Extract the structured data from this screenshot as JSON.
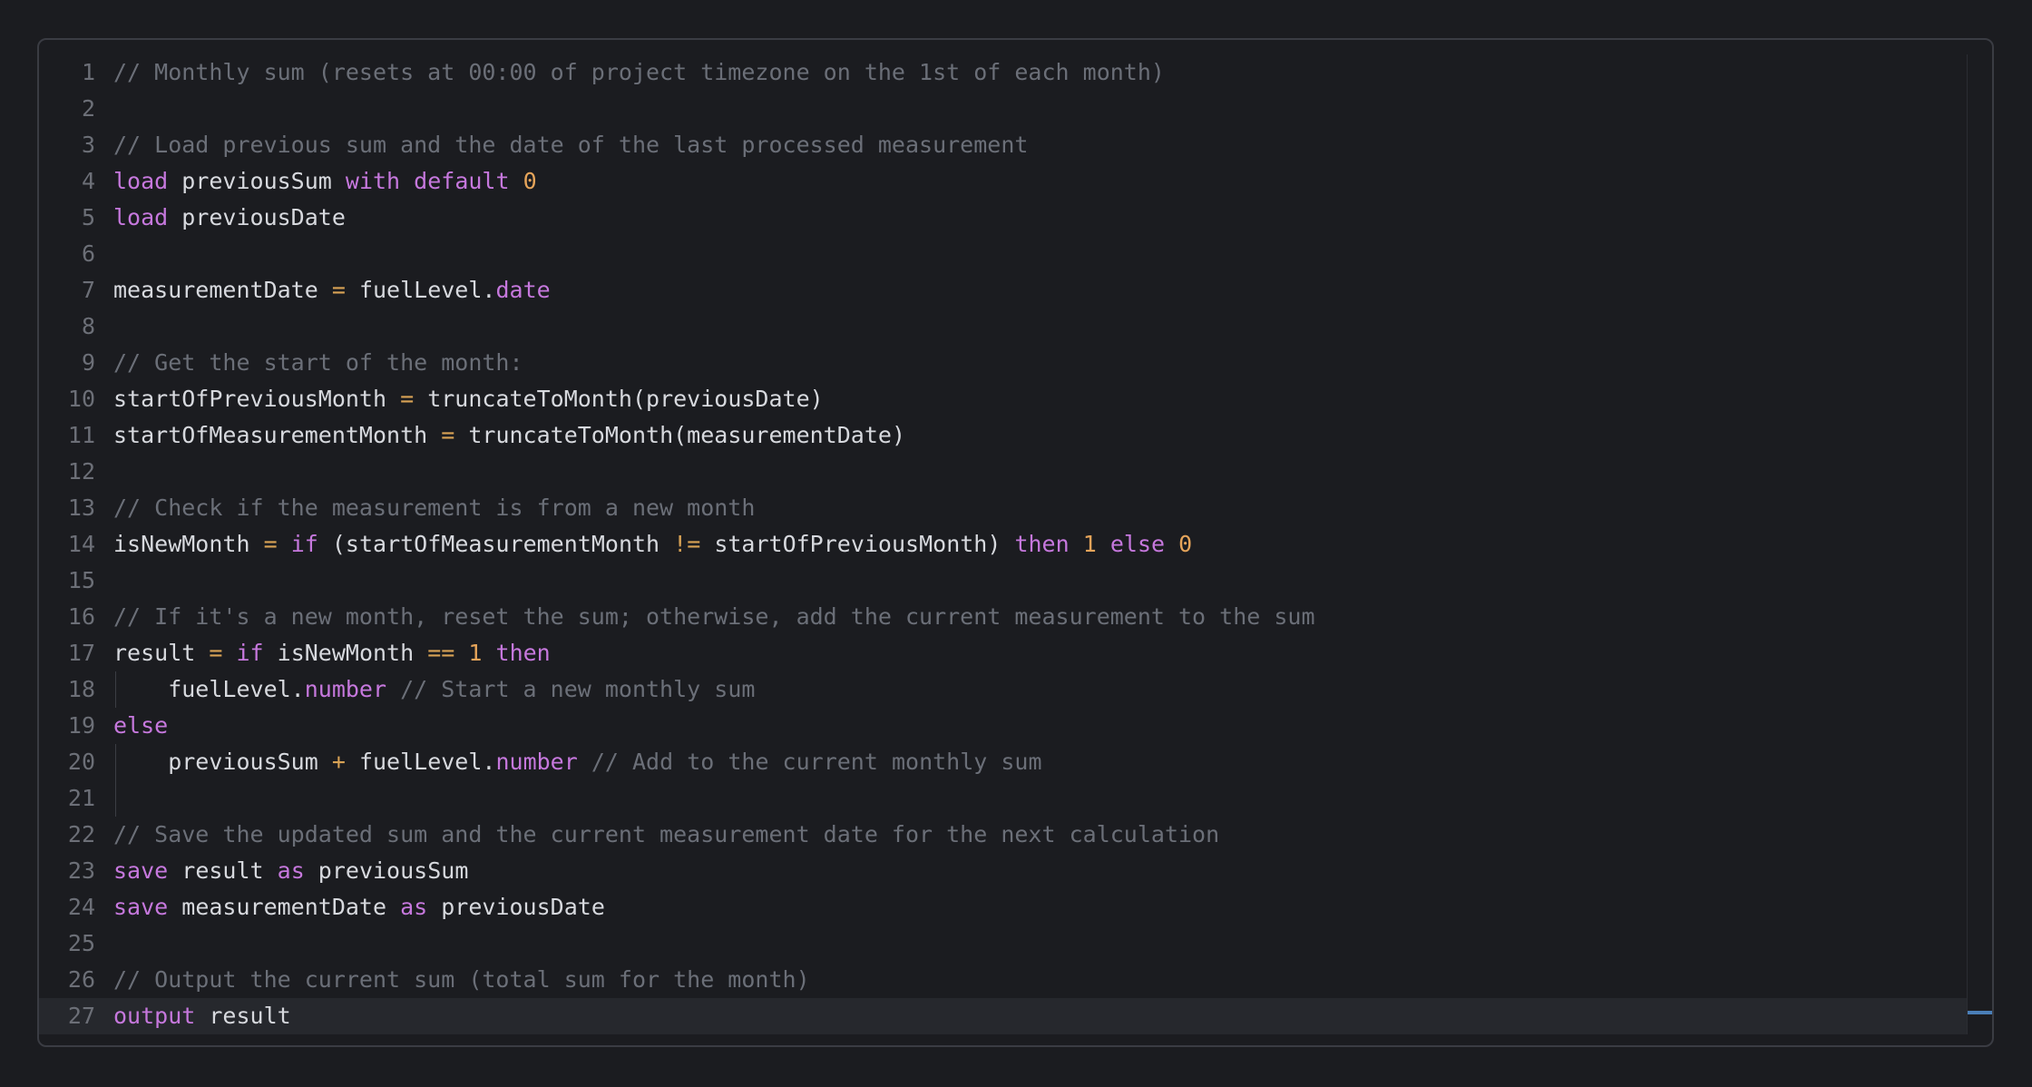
{
  "editor": {
    "lines": [
      {
        "n": "1",
        "tokens": [
          {
            "t": "// Monthly sum (resets at 00:00 of project timezone on the 1st of each month)",
            "c": "cm"
          }
        ]
      },
      {
        "n": "2",
        "tokens": []
      },
      {
        "n": "3",
        "tokens": [
          {
            "t": "// Load previous sum and the date of the last processed measurement",
            "c": "cm"
          }
        ]
      },
      {
        "n": "4",
        "tokens": [
          {
            "t": "load",
            "c": "kw"
          },
          {
            "t": " previousSum ",
            "c": "id"
          },
          {
            "t": "with",
            "c": "kw"
          },
          {
            "t": " ",
            "c": "id"
          },
          {
            "t": "default",
            "c": "kw"
          },
          {
            "t": " ",
            "c": "id"
          },
          {
            "t": "0",
            "c": "num"
          }
        ]
      },
      {
        "n": "5",
        "tokens": [
          {
            "t": "load",
            "c": "kw"
          },
          {
            "t": " previousDate",
            "c": "id"
          }
        ]
      },
      {
        "n": "6",
        "tokens": []
      },
      {
        "n": "7",
        "tokens": [
          {
            "t": "measurementDate ",
            "c": "id"
          },
          {
            "t": "=",
            "c": "op"
          },
          {
            "t": " fuelLevel.",
            "c": "id"
          },
          {
            "t": "date",
            "c": "kw"
          }
        ]
      },
      {
        "n": "8",
        "tokens": []
      },
      {
        "n": "9",
        "tokens": [
          {
            "t": "// Get the start of the month:",
            "c": "cm"
          }
        ]
      },
      {
        "n": "10",
        "tokens": [
          {
            "t": "startOfPreviousMonth ",
            "c": "id"
          },
          {
            "t": "=",
            "c": "op"
          },
          {
            "t": " truncateToMonth(previousDate)",
            "c": "id"
          }
        ]
      },
      {
        "n": "11",
        "tokens": [
          {
            "t": "startOfMeasurementMonth ",
            "c": "id"
          },
          {
            "t": "=",
            "c": "op"
          },
          {
            "t": " truncateToMonth(measurementDate)",
            "c": "id"
          }
        ]
      },
      {
        "n": "12",
        "tokens": []
      },
      {
        "n": "13",
        "tokens": [
          {
            "t": "// Check if the measurement is from a new month",
            "c": "cm"
          }
        ]
      },
      {
        "n": "14",
        "tokens": [
          {
            "t": "isNewMonth ",
            "c": "id"
          },
          {
            "t": "=",
            "c": "op"
          },
          {
            "t": " ",
            "c": "id"
          },
          {
            "t": "if",
            "c": "kw"
          },
          {
            "t": " (startOfMeasurementMonth ",
            "c": "id"
          },
          {
            "t": "!=",
            "c": "op"
          },
          {
            "t": " startOfPreviousMonth) ",
            "c": "id"
          },
          {
            "t": "then",
            "c": "kw"
          },
          {
            "t": " ",
            "c": "id"
          },
          {
            "t": "1",
            "c": "num"
          },
          {
            "t": " ",
            "c": "id"
          },
          {
            "t": "else",
            "c": "kw"
          },
          {
            "t": " ",
            "c": "id"
          },
          {
            "t": "0",
            "c": "num"
          }
        ]
      },
      {
        "n": "15",
        "tokens": []
      },
      {
        "n": "16",
        "tokens": [
          {
            "t": "// If it's a new month, reset the sum; otherwise, add the current measurement to the sum",
            "c": "cm"
          }
        ]
      },
      {
        "n": "17",
        "tokens": [
          {
            "t": "result ",
            "c": "id"
          },
          {
            "t": "=",
            "c": "op"
          },
          {
            "t": " ",
            "c": "id"
          },
          {
            "t": "if",
            "c": "kw"
          },
          {
            "t": " isNewMonth ",
            "c": "id"
          },
          {
            "t": "==",
            "c": "op"
          },
          {
            "t": " ",
            "c": "id"
          },
          {
            "t": "1",
            "c": "num"
          },
          {
            "t": " ",
            "c": "id"
          },
          {
            "t": "then",
            "c": "kw"
          }
        ]
      },
      {
        "n": "18",
        "guide": true,
        "tokens": [
          {
            "t": "    fuelLevel.",
            "c": "id"
          },
          {
            "t": "number",
            "c": "kw"
          },
          {
            "t": " // Start a new monthly sum",
            "c": "cm"
          }
        ]
      },
      {
        "n": "19",
        "tokens": [
          {
            "t": "else",
            "c": "kw"
          }
        ]
      },
      {
        "n": "20",
        "guide": true,
        "tokens": [
          {
            "t": "    previousSum ",
            "c": "id"
          },
          {
            "t": "+",
            "c": "op"
          },
          {
            "t": " fuelLevel.",
            "c": "id"
          },
          {
            "t": "number",
            "c": "kw"
          },
          {
            "t": " // Add to the current monthly sum",
            "c": "cm"
          }
        ]
      },
      {
        "n": "21",
        "guide": true,
        "tokens": []
      },
      {
        "n": "22",
        "tokens": [
          {
            "t": "// Save the updated sum and the current measurement date for the next calculation",
            "c": "cm"
          }
        ]
      },
      {
        "n": "23",
        "tokens": [
          {
            "t": "save",
            "c": "kw"
          },
          {
            "t": " result ",
            "c": "id"
          },
          {
            "t": "as",
            "c": "kw"
          },
          {
            "t": " previousSum",
            "c": "id"
          }
        ]
      },
      {
        "n": "24",
        "tokens": [
          {
            "t": "save",
            "c": "kw"
          },
          {
            "t": " measurementDate ",
            "c": "id"
          },
          {
            "t": "as",
            "c": "kw"
          },
          {
            "t": " previousDate",
            "c": "id"
          }
        ]
      },
      {
        "n": "25",
        "tokens": []
      },
      {
        "n": "26",
        "tokens": [
          {
            "t": "// Output the current sum (total sum for the month)",
            "c": "cm"
          }
        ]
      },
      {
        "n": "27",
        "active": true,
        "tokens": [
          {
            "t": "output",
            "c": "kw"
          },
          {
            "t": " result",
            "c": "id"
          }
        ]
      }
    ]
  },
  "colors": {
    "background": "#1b1c20",
    "keyword": "#c678dd",
    "operator": "#d8a255",
    "number": "#e5a45a",
    "comment": "#6b6f78",
    "text": "#d7d9de",
    "line_number": "#6c6f77",
    "scroll_marker": "#4a7fb8"
  }
}
